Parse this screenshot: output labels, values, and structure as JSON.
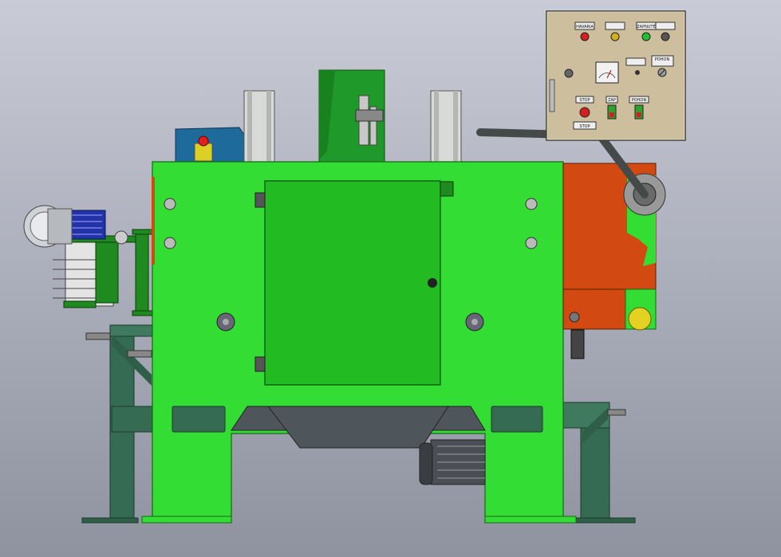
{
  "colors": {
    "body_green": "#33dd33",
    "door_green": "#22bb22",
    "dark_green": "#1f7a1f",
    "frame_green": "#356b52",
    "orange": "#d24a12",
    "panel_beige": "#cdbf9e",
    "steel": "#4e565c",
    "motor_blue": "#2233aa",
    "tank_blue": "#1e6a9a"
  },
  "control_panel": {
    "lamp_labels": [
      "HAVARIA",
      "",
      "ZAPNUTÉ",
      ""
    ],
    "lamp_colors": [
      "#d42020",
      "#d4b020",
      "#20c030",
      "#555555"
    ],
    "stop_label": "STOP",
    "start_label": "ZAP",
    "run_label": "POHON",
    "mode_label": "POHON",
    "lower_sign": "STOP"
  }
}
